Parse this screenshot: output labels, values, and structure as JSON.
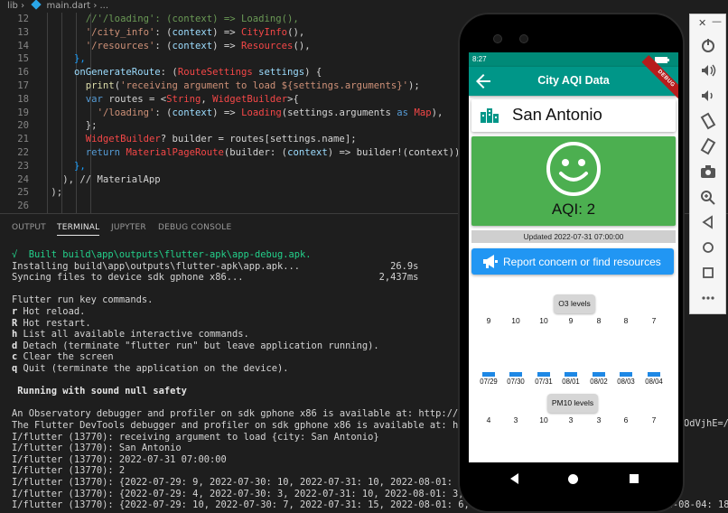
{
  "breadcrumb": {
    "folder": "lib",
    "sep": "›",
    "file": "main.dart",
    "tail": "› ..."
  },
  "editor": {
    "lines": [
      {
        "n": "12",
        "indent": 12,
        "tokens": [
          [
            "//'/loading': (context) => Loading(),",
            "com"
          ]
        ]
      },
      {
        "n": "13",
        "indent": 12,
        "tokens": [
          [
            "'/city_info'",
            "str"
          ],
          [
            ": (",
            ""
          ],
          [
            "context",
            "par"
          ],
          [
            ") => ",
            ""
          ],
          [
            "CityInfo",
            "err"
          ],
          [
            "(),",
            ""
          ]
        ]
      },
      {
        "n": "14",
        "indent": 12,
        "tokens": [
          [
            "'/resources'",
            "str"
          ],
          [
            ": (",
            ""
          ],
          [
            "context",
            "par"
          ],
          [
            ") => ",
            ""
          ],
          [
            "Resources",
            "err"
          ],
          [
            "(),",
            ""
          ]
        ]
      },
      {
        "n": "15",
        "indent": 10,
        "tokens": [
          [
            "},",
            "br3"
          ]
        ]
      },
      {
        "n": "16",
        "indent": 10,
        "tokens": [
          [
            "onGenerateRoute",
            "par"
          ],
          [
            ": (",
            ""
          ],
          [
            "RouteSettings",
            "err"
          ],
          [
            " ",
            ""
          ],
          [
            "settings",
            "par"
          ],
          [
            ") {",
            ""
          ]
        ]
      },
      {
        "n": "17",
        "indent": 12,
        "tokens": [
          [
            "print",
            "fn"
          ],
          [
            "(",
            ""
          ],
          [
            "'receiving argument to load ${settings.arguments}'",
            "str"
          ],
          [
            ");",
            ""
          ]
        ]
      },
      {
        "n": "18",
        "indent": 12,
        "tokens": [
          [
            "var",
            "kw"
          ],
          [
            " routes = <",
            ""
          ],
          [
            "String",
            "err"
          ],
          [
            ", ",
            ""
          ],
          [
            "WidgetBuilder",
            "err"
          ],
          [
            ">{",
            ""
          ]
        ]
      },
      {
        "n": "19",
        "indent": 14,
        "tokens": [
          [
            "'/loading'",
            "str"
          ],
          [
            ": (",
            ""
          ],
          [
            "context",
            "par"
          ],
          [
            ") => ",
            ""
          ],
          [
            "Loading",
            "err"
          ],
          [
            "(settings.arguments ",
            ""
          ],
          [
            "as",
            "kw"
          ],
          [
            " ",
            ""
          ],
          [
            "Map",
            "err"
          ],
          [
            "),",
            ""
          ]
        ]
      },
      {
        "n": "20",
        "indent": 12,
        "tokens": [
          [
            "};",
            ""
          ]
        ]
      },
      {
        "n": "21",
        "indent": 12,
        "tokens": [
          [
            "WidgetBuilder",
            "err"
          ],
          [
            "? builder = routes[settings.name];",
            ""
          ]
        ]
      },
      {
        "n": "22",
        "indent": 12,
        "tokens": [
          [
            "return",
            "kw"
          ],
          [
            " ",
            ""
          ],
          [
            "MaterialPageRoute",
            "err"
          ],
          [
            "(builder: (",
            ""
          ],
          [
            "context",
            "par"
          ],
          [
            ") => builder!(context))",
            ""
          ]
        ]
      },
      {
        "n": "23",
        "indent": 10,
        "tokens": [
          [
            "},",
            "br3"
          ]
        ]
      },
      {
        "n": "24",
        "indent": 8,
        "tokens": [
          [
            "), // MaterialApp",
            ""
          ]
        ]
      },
      {
        "n": "25",
        "indent": 6,
        "tokens": [
          [
            ");",
            ""
          ]
        ]
      },
      {
        "n": "26",
        "indent": 4,
        "tokens": [
          [
            "",
            ""
          ]
        ]
      }
    ]
  },
  "panel": {
    "tabs": [
      {
        "label": "OUTPUT",
        "active": false
      },
      {
        "label": "TERMINAL",
        "active": true
      },
      {
        "label": "JUPYTER",
        "active": false
      },
      {
        "label": "DEBUG CONSOLE",
        "active": false
      }
    ]
  },
  "terminal": {
    "lines": [
      {
        "text": "√  Built build\\app\\outputs\\flutter-apk\\app-debug.apk.",
        "style": "green"
      },
      {
        "text": "Installing build\\app\\outputs\\flutter-apk\\app.apk...                26.9s",
        "style": ""
      },
      {
        "text": "Syncing files to device sdk gphone x86...                        2,437ms",
        "style": ""
      },
      {
        "text": "",
        "style": ""
      },
      {
        "text": "Flutter run key commands.",
        "style": ""
      },
      {
        "text": "r Hot reload.",
        "style": "key"
      },
      {
        "text": "R Hot restart.",
        "style": "key"
      },
      {
        "text": "h List all available interactive commands.",
        "style": "key"
      },
      {
        "text": "d Detach (terminate \"flutter run\" but leave application running).",
        "style": "key"
      },
      {
        "text": "c Clear the screen",
        "style": "key"
      },
      {
        "text": "q Quit (terminate the application on the device).",
        "style": "key"
      },
      {
        "text": "",
        "style": ""
      },
      {
        "text": " Running with sound null safety",
        "style": "bold"
      },
      {
        "text": "",
        "style": ""
      },
      {
        "text": "An Observatory debugger and profiler on sdk gphone x86 is available at: http://127.0.0.",
        "style": ""
      },
      {
        "text": "The Flutter DevTools debugger and profiler on sdk gphone x86 is available at: http://12",
        "style": ""
      },
      {
        "text": "I/flutter (13770): receiving argument to load {city: San Antonio}",
        "style": ""
      },
      {
        "text": "I/flutter (13770): San Antonio",
        "style": ""
      },
      {
        "text": "I/flutter (13770): 2022-07-31 07:00:00",
        "style": ""
      },
      {
        "text": "I/flutter (13770): 2",
        "style": ""
      },
      {
        "text": "I/flutter (13770): {2022-07-29: 9, 2022-07-30: 10, 2022-07-31: 10, 2022-08-01: 9, 2022-",
        "style": ""
      },
      {
        "text": "I/flutter (13770): {2022-07-29: 4, 2022-07-30: 3, 2022-07-31: 10, 2022-08-01: 3, 2022-08",
        "style": ""
      },
      {
        "text": "I/flutter (13770): {2022-07-29: 10, 2022-07-30: 7, 2022-07-31: 15, 2022-08-01: 6, 2022-08-02: 7, 2022-08-03: 14, 2022-08-04: 18}",
        "style": ""
      }
    ],
    "overflow_text": "OdVjhE=/"
  },
  "app": {
    "status_time": "8:27",
    "title": "City AQI Data",
    "debug_banner": "DEBUG",
    "city": "San Antonio",
    "aqi_label": "AQI: 2",
    "aqi_color": "#4caf50",
    "updated": "Updated 2022-07-31 07:00:00",
    "report_button": "Report concern or find resources",
    "o3": {
      "label": "O3 levels",
      "values": [
        "9",
        "10",
        "10",
        "9",
        "8",
        "8",
        "7"
      ],
      "dates": [
        "07/29",
        "07/30",
        "07/31",
        "08/01",
        "08/02",
        "08/03",
        "08/04"
      ]
    },
    "pm10": {
      "label": "PM10 levels",
      "values": [
        "4",
        "3",
        "10",
        "3",
        "3",
        "6",
        "7"
      ]
    }
  }
}
